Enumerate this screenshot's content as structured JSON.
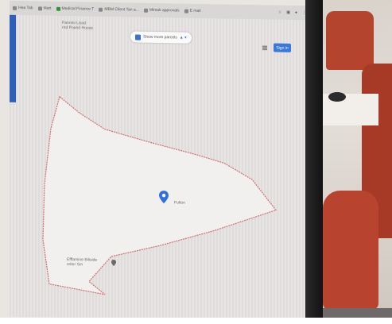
{
  "screen": {
    "tabs": [
      {
        "label": "Hea Tab"
      },
      {
        "label": "Mart"
      },
      {
        "label": "Medical Finance T"
      },
      {
        "label": "MBM Client Tan a..."
      },
      {
        "label": "Mimak approvals"
      },
      {
        "label": "E mail"
      }
    ],
    "search_chip": {
      "label": "Show more parcels",
      "extra": "▲ ▾"
    },
    "top_left_label": "Pannini Lisod\nrnd Pound House",
    "sign_in_label": "Sign in",
    "pin_label": "Fulton",
    "bottom_left_label": "Efffamine Biliside\nsriter Sm"
  },
  "colors": {
    "polygon_stroke": "#d07070",
    "polygon_fill": "#f2f0ef",
    "pin": "#2f6fe0",
    "sign_in_bg": "#3c78d8"
  },
  "icons": {
    "map_pin": "map-pin-icon",
    "apps_grid": "apps-grid-icon"
  }
}
